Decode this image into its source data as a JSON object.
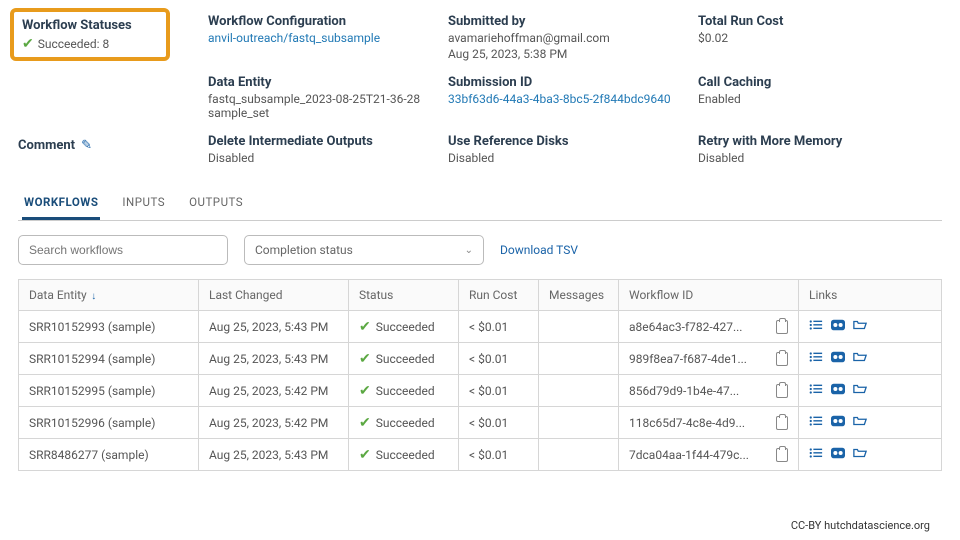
{
  "info": {
    "statuses_label": "Workflow Statuses",
    "succeeded_text": "Succeeded: 8",
    "config_label": "Workflow Configuration",
    "config_value": "anvil-outreach/fastq_subsample",
    "entity_label": "Data Entity",
    "entity_value": "fastq_subsample_2023-08-25T21-36-28 sample_set",
    "submitted_label": "Submitted by",
    "submitted_email": "avamariehoffman@gmail.com",
    "submitted_time": "Aug 25, 2023, 5:38 PM",
    "subid_label": "Submission ID",
    "subid_value": "33bf63d6-44a3-4ba3-8bc5-2f844bdc9640",
    "cost_label": "Total Run Cost",
    "cost_value": "$0.02",
    "caching_label": "Call Caching",
    "caching_value": "Enabled",
    "comment_label": "Comment",
    "delete_label": "Delete Intermediate Outputs",
    "delete_value": "Disabled",
    "refdisk_label": "Use Reference Disks",
    "refdisk_value": "Disabled",
    "retry_label": "Retry with More Memory",
    "retry_value": "Disabled"
  },
  "tabs": {
    "workflows": "WORKFLOWS",
    "inputs": "INPUTS",
    "outputs": "OUTPUTS"
  },
  "controls": {
    "search_placeholder": "Search workflows",
    "completion_label": "Completion status",
    "download_tsv": "Download TSV"
  },
  "table": {
    "headers": {
      "entity": "Data Entity",
      "last": "Last Changed",
      "status": "Status",
      "cost": "Run Cost",
      "messages": "Messages",
      "wfid": "Workflow ID",
      "links": "Links"
    },
    "rows": [
      {
        "entity": "SRR10152993 (sample)",
        "last": "Aug 25, 2023, 5:43 PM",
        "status": "Succeeded",
        "cost": "< $0.01",
        "msg": "",
        "wfid": "a8e64ac3-f782-427..."
      },
      {
        "entity": "SRR10152994 (sample)",
        "last": "Aug 25, 2023, 5:43 PM",
        "status": "Succeeded",
        "cost": "< $0.01",
        "msg": "",
        "wfid": "989f8ea7-f687-4de1..."
      },
      {
        "entity": "SRR10152995 (sample)",
        "last": "Aug 25, 2023, 5:42 PM",
        "status": "Succeeded",
        "cost": "< $0.01",
        "msg": "",
        "wfid": "856d79d9-1b4e-47..."
      },
      {
        "entity": "SRR10152996 (sample)",
        "last": "Aug 25, 2023, 5:42 PM",
        "status": "Succeeded",
        "cost": "< $0.01",
        "msg": "",
        "wfid": "118c65d7-4c8e-4d9..."
      },
      {
        "entity": "SRR8486277 (sample)",
        "last": "Aug 25, 2023, 5:43 PM",
        "status": "Succeeded",
        "cost": "< $0.01",
        "msg": "",
        "wfid": "7dca04aa-1f44-479c..."
      }
    ]
  },
  "footer": {
    "attribution": "CC-BY  hutchdatascience.org"
  }
}
